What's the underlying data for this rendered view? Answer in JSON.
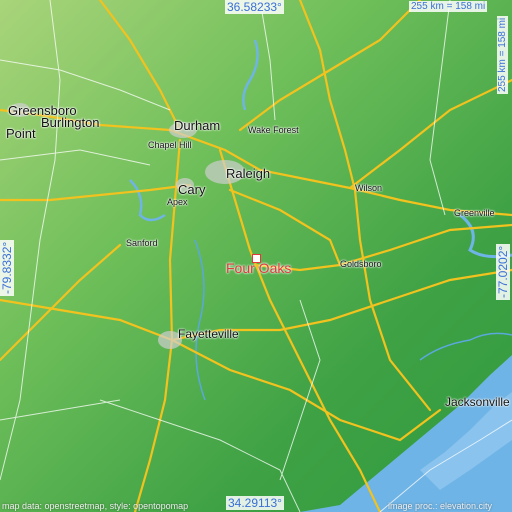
{
  "map": {
    "focus_place": "Four Oaks",
    "cities": {
      "greensboro": "Greensboro",
      "burlington": "Burlington",
      "point": "Point",
      "durham": "Durham",
      "wake_forest": "Wake Forest",
      "chapel_hill": "Chapel Hill",
      "raleigh": "Raleigh",
      "cary": "Cary",
      "apex": "Apex",
      "wilson": "Wilson",
      "greenville": "Greenville",
      "sanford": "Sanford",
      "goldsboro": "Goldsboro",
      "fayetteville": "Fayetteville",
      "jacksonville": "Jacksonville"
    },
    "coords": {
      "top": "36.58233°",
      "bottom": "34.29113°",
      "left": "-79.8332°",
      "right": "-77.0202°"
    },
    "scale": {
      "horizontal": "255 km = 158 mi",
      "vertical": "255 km = 158 mi"
    },
    "credits": {
      "left": "map data: openstreetmap, style: opentopomap",
      "right": "image proc.: elevation.city"
    },
    "colors": {
      "lowland": "#3fa245",
      "upland": "#8fca6a",
      "water": "#6fb4e6",
      "road": "#f2c21e",
      "focus": "#e03a3a",
      "coordinate_text": "#3a6fd8"
    }
  }
}
